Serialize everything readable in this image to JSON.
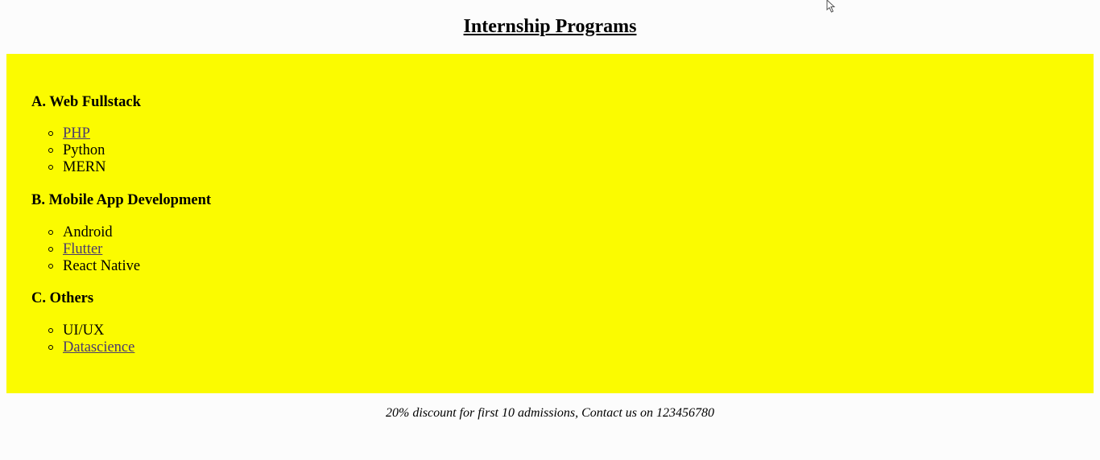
{
  "page": {
    "title": "Internship Programs",
    "panel_color": "#fbfb00",
    "footer": "20% discount for first 10 admissions, Contact us on 123456780"
  },
  "sections": [
    {
      "heading": "A. Web Fullstack",
      "items": [
        {
          "label": "PHP",
          "link": true
        },
        {
          "label": "Python",
          "link": false
        },
        {
          "label": "MERN",
          "link": false
        }
      ]
    },
    {
      "heading": "B. Mobile App Development",
      "items": [
        {
          "label": "Android",
          "link": false
        },
        {
          "label": "Flutter",
          "link": true
        },
        {
          "label": "React Native",
          "link": false
        }
      ]
    },
    {
      "heading": "C. Others",
      "items": [
        {
          "label": "UI/UX",
          "link": false
        },
        {
          "label": "Datascience",
          "link": true
        }
      ]
    }
  ],
  "icons": {
    "cursor": "mouse-pointer-icon"
  }
}
